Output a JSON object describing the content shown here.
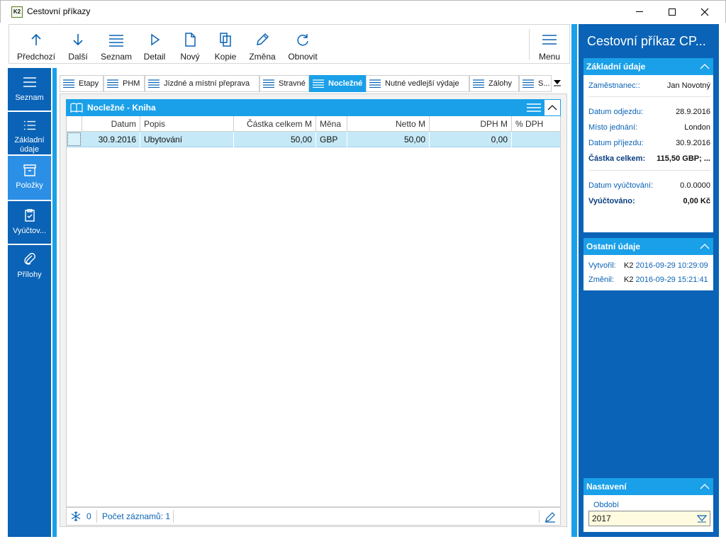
{
  "window": {
    "title": "Cestovní příkazy",
    "icon_text": "K2"
  },
  "toolbar": {
    "items": [
      {
        "label": "Předchozí",
        "icon": "arrow-up-icon"
      },
      {
        "label": "Další",
        "icon": "arrow-down-icon"
      },
      {
        "label": "Seznam",
        "icon": "list-icon"
      },
      {
        "label": "Detail",
        "icon": "play-icon"
      },
      {
        "label": "Nový",
        "icon": "new-document-icon"
      },
      {
        "label": "Kopie",
        "icon": "copy-icon"
      },
      {
        "label": "Změna",
        "icon": "pencil-icon"
      },
      {
        "label": "Obnovit",
        "icon": "refresh-icon"
      }
    ],
    "menu_label": "Menu"
  },
  "leftnav": {
    "items": [
      {
        "label": "Seznam",
        "icon": "list-icon"
      },
      {
        "label": "Základní údaje",
        "icon": "list-bullets-icon"
      },
      {
        "label": "Položky",
        "icon": "box-icon"
      },
      {
        "label": "Vyúčtov...",
        "icon": "clipboard-check-icon"
      },
      {
        "label": "Přílohy",
        "icon": "paperclip-icon"
      }
    ]
  },
  "tabs": [
    {
      "label": "Etapy"
    },
    {
      "label": "PHM"
    },
    {
      "label": "Jízdné a místní přeprava"
    },
    {
      "label": "Stravné"
    },
    {
      "label": "Nocležné"
    },
    {
      "label": "Nutné vedlejší výdaje"
    },
    {
      "label": "Zálohy"
    },
    {
      "label": "S..."
    }
  ],
  "panel": {
    "title": "Nocležné - Kniha",
    "columns": [
      "Datum",
      "Popis",
      "Částka celkem M",
      "Měna",
      "Netto M",
      "DPH M",
      "% DPH"
    ],
    "rows": [
      {
        "datum": "30.9.2016",
        "popis": "Ubytování",
        "castka": "50,00",
        "mena": "GBP",
        "netto": "50,00",
        "dph": "0,00",
        "pct": ""
      }
    ],
    "footer": {
      "count": "0",
      "records": "Počet záznamů: 1"
    }
  },
  "right": {
    "title": "Cestovní příkaz CP...",
    "basic": {
      "title": "Základní údaje",
      "employee_label": "Zaměstnanec::",
      "employee_value": "Jan Novotný",
      "departure_label": "Datum odjezdu:",
      "departure_value": "28.9.2016",
      "place_label": "Místo jednání:",
      "place_value": "London",
      "arrival_label": "Datum příjezdu:",
      "arrival_value": "30.9.2016",
      "total_label": "Částka celkem:",
      "total_value": "115,50 GBP; ...",
      "settle_date_label": "Datum vyúčtování:",
      "settle_date_value": "0.0.0000",
      "settled_label": "Vyúčtováno:",
      "settled_value": "0,00 Kč"
    },
    "other": {
      "title": "Ostatní údaje",
      "created_label": "Vytvořil:",
      "created_user": "K2",
      "created_time": "2016-09-29 10:29:09",
      "changed_label": "Změnil:",
      "changed_user": "K2",
      "changed_time": "2016-09-29 15:21:41"
    },
    "settings": {
      "title": "Nastavení",
      "period_label": "Období",
      "period_value": "2017"
    }
  },
  "colors": {
    "nav": "#0a63b6",
    "accent": "#1aa0e8",
    "row_selected": "#c6e9f7"
  }
}
